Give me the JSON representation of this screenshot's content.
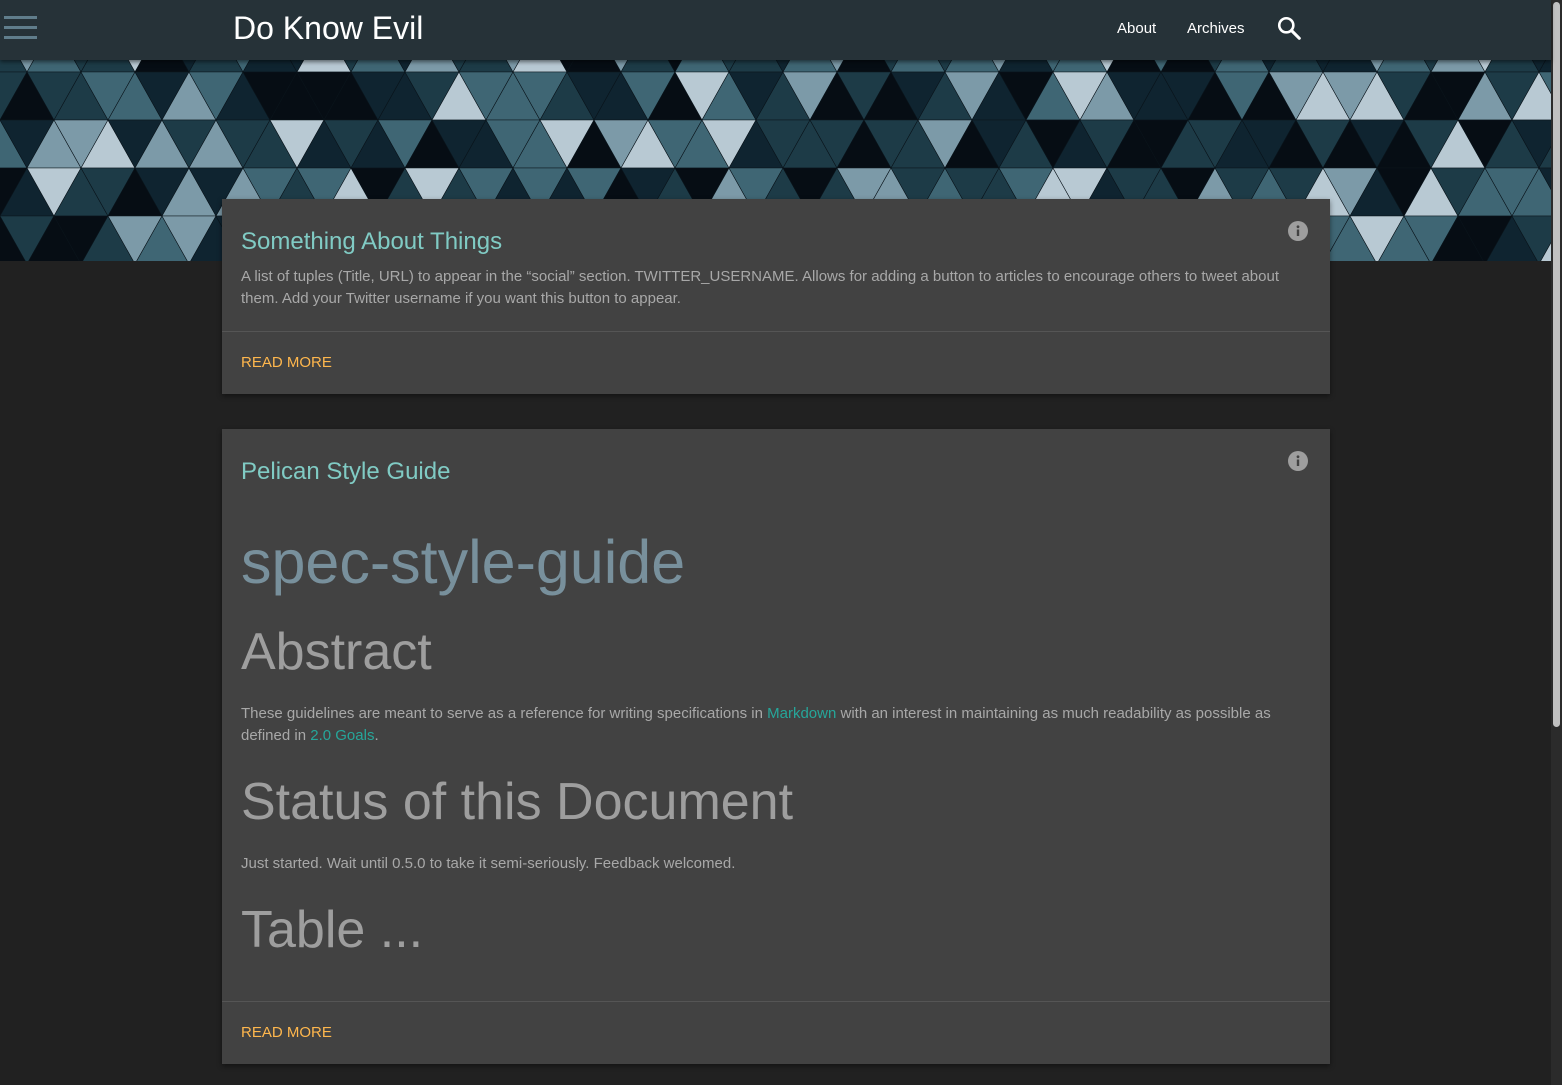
{
  "header": {
    "site_title": "Do Know Evil",
    "nav": [
      {
        "label": "About"
      },
      {
        "label": "Archives"
      }
    ]
  },
  "posts": [
    {
      "title": "Something About Things",
      "summary": "A list of tuples (Title, URL) to appear in the “social” section. TWITTER_USERNAME. Allows for adding a button to articles to encourage others to tweet about them. Add your Twitter username if you want this button to appear.",
      "read_more": "READ MORE"
    },
    {
      "title": "Pelican Style Guide",
      "h1": "spec-style-guide",
      "h2_abstract": "Abstract",
      "abstract_before": "These guidelines are meant to serve as a reference for writing specifications in ",
      "abstract_link1": "Markdown",
      "abstract_middle": " with an interest in maintaining as much readability as possible as defined in ",
      "abstract_link2": "2.0 Goals",
      "abstract_after": ".",
      "h2_status": "Status of this Document",
      "status_text": "Just started. Wait until 0.5.0 to take it semi-seriously. Feedback welcomed.",
      "h2_table": "Table ...",
      "read_more": "READ MORE"
    }
  ],
  "colors": {
    "topbar": "#263238",
    "background": "#212121",
    "card": "#424242",
    "title_accent": "#80cbc4",
    "link": "#26a69a",
    "read_more": "#ffb74d"
  },
  "icons": {
    "menu": "hamburger-icon",
    "search": "search-icon",
    "info": "info-icon"
  }
}
